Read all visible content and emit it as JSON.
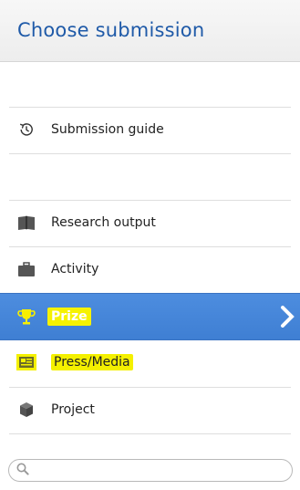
{
  "header": {
    "title": "Choose submission"
  },
  "menu": {
    "items": [
      {
        "label": "Submission guide",
        "icon": "clock-history-icon"
      },
      {
        "label": "Research output",
        "icon": "book-icon"
      },
      {
        "label": "Activity",
        "icon": "briefcase-icon"
      },
      {
        "label": "Prize",
        "icon": "trophy-icon",
        "selected": true
      },
      {
        "label": "Press/Media",
        "icon": "newspaper-icon",
        "highlighted": true
      },
      {
        "label": "Project",
        "icon": "cube-icon"
      }
    ]
  },
  "search": {
    "value": "",
    "placeholder": ""
  },
  "colors": {
    "title": "#1f5aa8",
    "selected_row": "#4d8ddf",
    "highlight": "#f4f000"
  }
}
